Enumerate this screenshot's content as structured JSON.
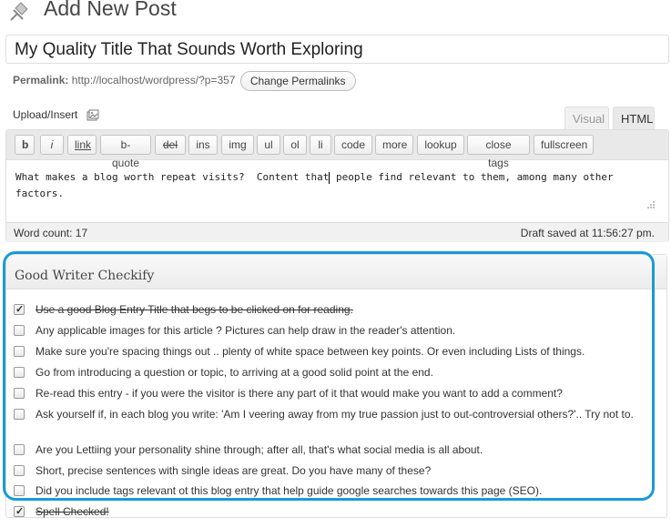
{
  "header": {
    "title": "Add New Post"
  },
  "post": {
    "title_value": "My Quality Title That Sounds Worth Exploring"
  },
  "permalink": {
    "label": "Permalink:",
    "url": "http://localhost/wordpress/?p=357",
    "change_button": "Change Permalinks"
  },
  "media": {
    "upload_insert_label": "Upload/Insert"
  },
  "editor_tabs": {
    "visual": "Visual",
    "html": "HTML",
    "active": "HTML"
  },
  "quicktags": [
    "b",
    "i",
    "link",
    "b-quote",
    "del",
    "ins",
    "img",
    "ul",
    "ol",
    "li",
    "code",
    "more",
    "lookup",
    "close tags",
    "fullscreen"
  ],
  "editor": {
    "content_before_caret": "What makes a blog worth repeat visits?  Content that",
    "content_after_caret": " people find relevant to them, among many other\nfactors.",
    "word_count": "Word count: 17",
    "draft_saved": "Draft saved at 11:56:27 pm."
  },
  "checkify": {
    "title": "Good Writer Checkify",
    "items": [
      {
        "text": "Use a good Blog Entry Title that begs to be clicked on for reading.",
        "checked": true
      },
      {
        "text": "Any applicable images for this article ? Pictures can help draw in the reader's attention.",
        "checked": false
      },
      {
        "text": "Make sure you're spacing things out .. plenty of white space between key points. Or even including Lists of things.",
        "checked": false
      },
      {
        "text": "Go from introducing a question or topic, to arriving at a good solid point at the end.",
        "checked": false
      },
      {
        "text": "Re-read this entry - if you were the visitor is there any part of it that would make you want to add a comment?",
        "checked": false
      },
      {
        "text": "Ask yourself if, in each blog you write: 'Am I veering away from my true passion just to out-controversial others?'.. Try not to.",
        "checked": false
      },
      {
        "text": "Are you Lettiing your personality shine through; after all, that's what social media is all about.",
        "checked": false
      },
      {
        "text": "Short, precise sentences with single ideas are great. Do you have many of these?",
        "checked": false
      },
      {
        "text": "Did you include tags relevant ot this blog entry that help guide google searches towards this page (SEO).",
        "checked": false
      },
      {
        "text": "Spell Checked!",
        "checked": true
      }
    ]
  },
  "colors": {
    "highlight": "#1a9ad6"
  }
}
